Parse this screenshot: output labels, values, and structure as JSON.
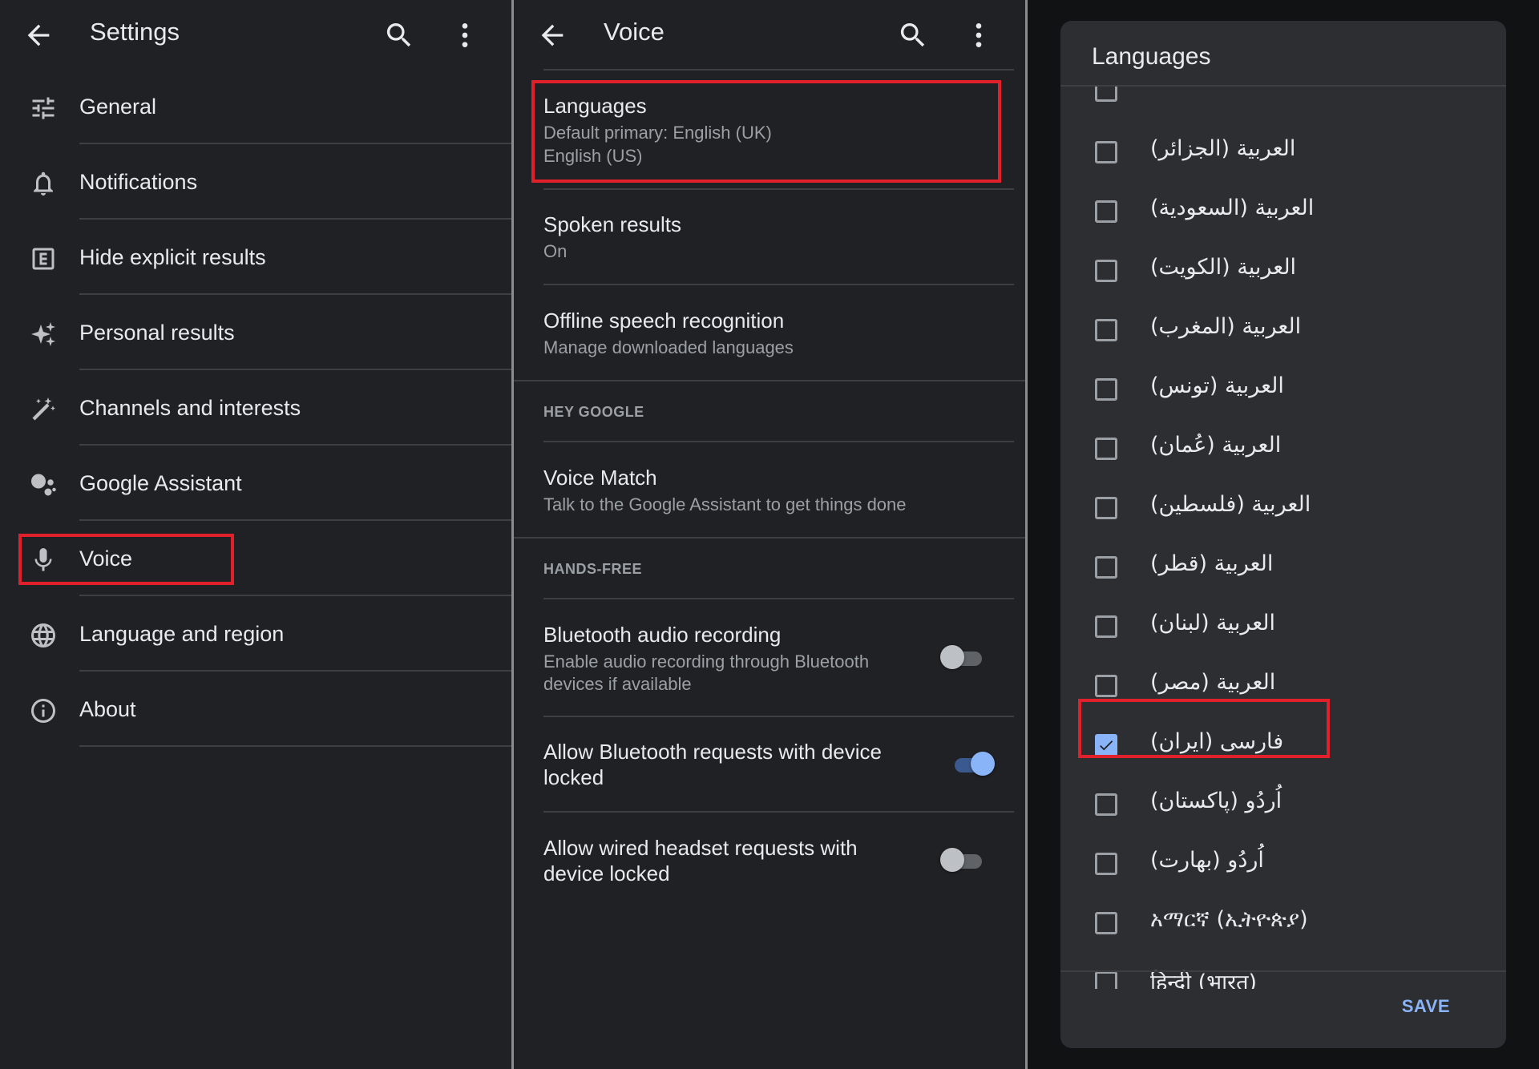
{
  "colors": {
    "background": "#202124",
    "highlight": "#e0212b",
    "accent": "#8ab4f8"
  },
  "settings": {
    "title": "Settings",
    "items": [
      {
        "label": "General",
        "icon": "tune-icon"
      },
      {
        "label": "Notifications",
        "icon": "bell-icon"
      },
      {
        "label": "Hide explicit results",
        "icon": "explicit-icon"
      },
      {
        "label": "Personal results",
        "icon": "sparkle-icon"
      },
      {
        "label": "Channels and interests",
        "icon": "magic-wand-icon"
      },
      {
        "label": "Google Assistant",
        "icon": "assistant-icon"
      },
      {
        "label": "Voice",
        "icon": "microphone-icon",
        "highlighted": true
      },
      {
        "label": "Language and region",
        "icon": "globe-icon"
      },
      {
        "label": "About",
        "icon": "info-icon"
      }
    ]
  },
  "voice": {
    "title": "Voice",
    "languages": {
      "title": "Languages",
      "line1": "Default primary: English (UK)",
      "line2": "English (US)"
    },
    "spoken": {
      "title": "Spoken results",
      "subtitle": "On"
    },
    "offline": {
      "title": "Offline speech recognition",
      "subtitle": "Manage downloaded languages"
    },
    "hey_google_header": "HEY GOOGLE",
    "voice_match": {
      "title": "Voice Match",
      "subtitle": "Talk to the Google Assistant to get things done"
    },
    "hands_free_header": "HANDS-FREE",
    "bt_audio": {
      "title": "Bluetooth audio recording",
      "subtitle_line1": "Enable audio recording through Bluetooth",
      "subtitle_line2": "devices if available",
      "toggle": "off"
    },
    "bt_requests": {
      "title_line1": "Allow Bluetooth requests with device",
      "title_line2": "locked",
      "toggle": "on"
    },
    "wired": {
      "title_line1": "Allow wired headset requests with",
      "title_line2": "device locked",
      "toggle": "off"
    }
  },
  "dialog": {
    "title": "Languages",
    "items": [
      {
        "label": "العربية (الجزائر)",
        "checked": false
      },
      {
        "label": "العربية (السعودية)",
        "checked": false
      },
      {
        "label": "العربية (الكويت)",
        "checked": false
      },
      {
        "label": "العربية (المغرب)",
        "checked": false
      },
      {
        "label": "العربية (تونس)",
        "checked": false
      },
      {
        "label": "العربية (عُمان)",
        "checked": false
      },
      {
        "label": "العربية (فلسطين)",
        "checked": false
      },
      {
        "label": "العربية (قطر)",
        "checked": false
      },
      {
        "label": "العربية (لبنان)",
        "checked": false
      },
      {
        "label": "العربية (مصر)",
        "checked": false
      },
      {
        "label": "فارسی (ایران)",
        "checked": true
      },
      {
        "label": "اُردُو (پاکستان)",
        "checked": false
      },
      {
        "label": "اُردُو (بھارت)",
        "checked": false
      },
      {
        "label": "አማርኛ (ኢትዮጵያ)",
        "checked": false
      },
      {
        "label": "हिन्दी (भारत)",
        "checked": false
      }
    ],
    "save_label": "SAVE"
  }
}
